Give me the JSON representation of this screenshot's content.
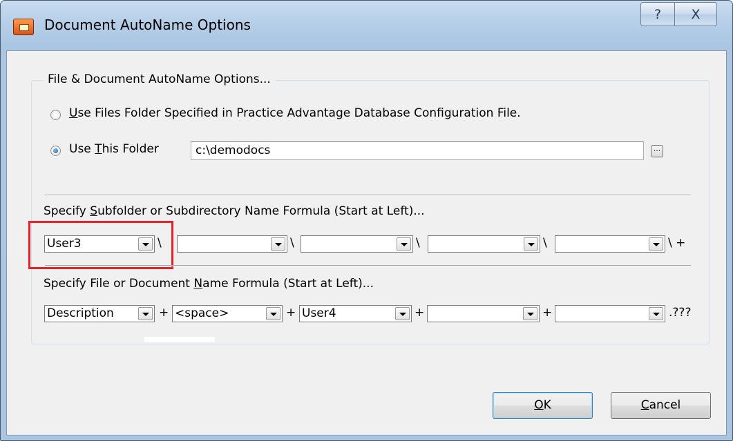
{
  "window": {
    "title": "Document AutoName Options",
    "help_label": "?",
    "close_label": "X"
  },
  "folder_group": {
    "legend": "File & Document AutoName Options...",
    "option1": {
      "mnemonic": "U",
      "rest": "se Files Folder Specified in Practice Advantage Database Configuration File.",
      "checked": false
    },
    "option2": {
      "prefix": "Use ",
      "mnemonic": "T",
      "rest": "his Folder",
      "checked": true
    },
    "folder_value": "c:\\demodocs",
    "browse_label": "..."
  },
  "subfolder": {
    "label_prefix": "Specify ",
    "label_mnemonic": "S",
    "label_rest": "ubfolder or Subdirectory Name Formula (Start at Left)...",
    "combos": [
      "User3",
      "",
      "",
      "",
      ""
    ],
    "separators": [
      "\\",
      "\\",
      "\\",
      "\\",
      "\\ +"
    ]
  },
  "filename": {
    "label_prefix": "Specify File or Document ",
    "label_mnemonic": "N",
    "label_rest": "ame Formula (Start at Left)...",
    "combos": [
      "Description",
      "<space>",
      "User4",
      "",
      ""
    ],
    "separators": [
      "+",
      "+",
      "+",
      "+",
      ".???"
    ]
  },
  "buttons": {
    "ok_mnemonic": "O",
    "ok_rest": "K",
    "cancel_mnemonic": "C",
    "cancel_rest": "ancel"
  },
  "colors": {
    "highlight": "#e8202a",
    "title_bar": "#b7cfe8"
  }
}
